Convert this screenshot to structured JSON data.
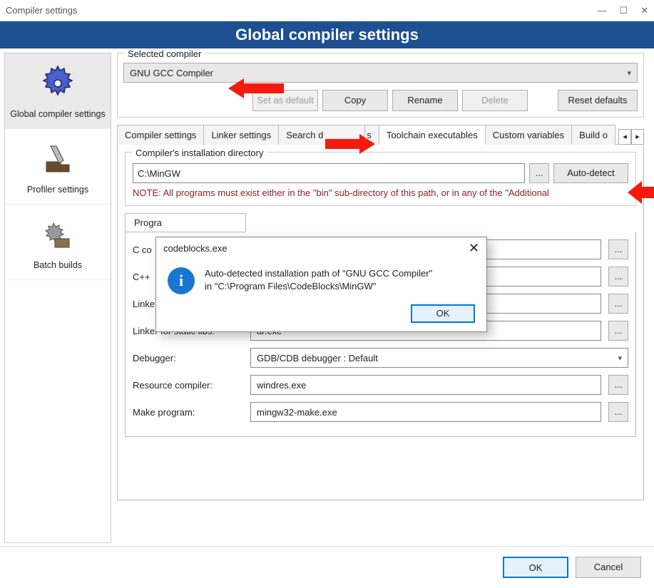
{
  "window": {
    "title": "Compiler settings"
  },
  "banner": "Global compiler settings",
  "sidebar": {
    "items": [
      {
        "label": "Global compiler settings"
      },
      {
        "label": "Profiler settings"
      },
      {
        "label": "Batch builds"
      }
    ]
  },
  "selected_compiler": {
    "group_title": "Selected compiler",
    "value": "GNU GCC Compiler",
    "buttons": {
      "set_default": "Set as default",
      "copy": "Copy",
      "rename": "Rename",
      "delete": "Delete",
      "reset": "Reset defaults"
    }
  },
  "tabs": {
    "list": [
      "Compiler settings",
      "Linker settings",
      "Search d",
      "s",
      "Toolchain executables",
      "Custom variables",
      "Build o"
    ],
    "active_index": 4
  },
  "install_dir": {
    "group_title": "Compiler's installation directory",
    "path": "C:\\MinGW",
    "browse": "...",
    "auto": "Auto-detect",
    "note": "NOTE: All programs must exist either in the \"bin\" sub-directory of this path, or in any of the \"Additional"
  },
  "program_files": {
    "tab_label": "Progra",
    "rows": [
      {
        "label": "C co",
        "value": ""
      },
      {
        "label": "C++",
        "value": ""
      },
      {
        "label": "Linke",
        "value": ""
      },
      {
        "label": "Linker for static libs:",
        "value": "ar.exe"
      },
      {
        "label": "Debugger:",
        "value": "GDB/CDB debugger : Default"
      },
      {
        "label": "Resource compiler:",
        "value": "windres.exe"
      },
      {
        "label": "Make program:",
        "value": "mingw32-make.exe"
      }
    ],
    "dots": "..."
  },
  "dialog": {
    "title": "codeblocks.exe",
    "line1": "Auto-detected installation path of \"GNU GCC Compiler\"",
    "line2": "in \"C:\\Program Files\\CodeBlocks\\MinGW\"",
    "ok": "OK"
  },
  "footer": {
    "ok": "OK",
    "cancel": "Cancel"
  },
  "icons": {
    "info": "i"
  }
}
